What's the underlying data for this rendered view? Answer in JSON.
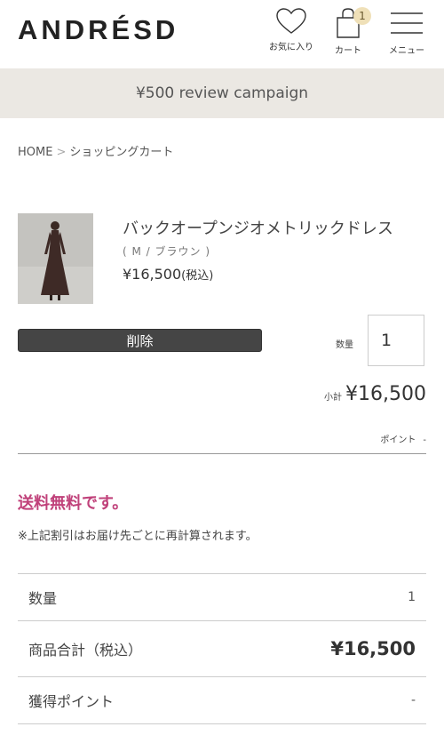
{
  "header": {
    "logo": "ANDRÉSD",
    "favorites_label": "お気に入り",
    "cart_label": "カート",
    "cart_count": "1",
    "menu_label": "メニュー"
  },
  "campaign": {
    "text": "¥500 review campaign"
  },
  "breadcrumb": {
    "home": "HOME",
    "separator": ">",
    "current": "ショッピングカート"
  },
  "cart_item": {
    "name": "バックオープンジオメトリックドレス",
    "variant": "( M / ブラウン )",
    "price": "¥16,500",
    "tax_note": "(税込)",
    "delete_label": "削除",
    "quantity_label": "数量",
    "quantity": "1",
    "subtotal_label": "小計",
    "subtotal": "¥16,500",
    "points_label": "ポイント",
    "points_value": "-"
  },
  "shipping": {
    "free_message": "送料無料です。",
    "note": "※上記割引はお届け先ごとに再計算されます。"
  },
  "summary": {
    "rows": [
      {
        "label": "数量",
        "value": "1"
      },
      {
        "label": "商品合計（税込）",
        "value": "¥16,500"
      },
      {
        "label": "獲得ポイント",
        "value": "-"
      }
    ]
  },
  "colors": {
    "accent": "#c0417a",
    "campaign_bg": "#ebe8e3",
    "delete_bg": "#454545"
  }
}
